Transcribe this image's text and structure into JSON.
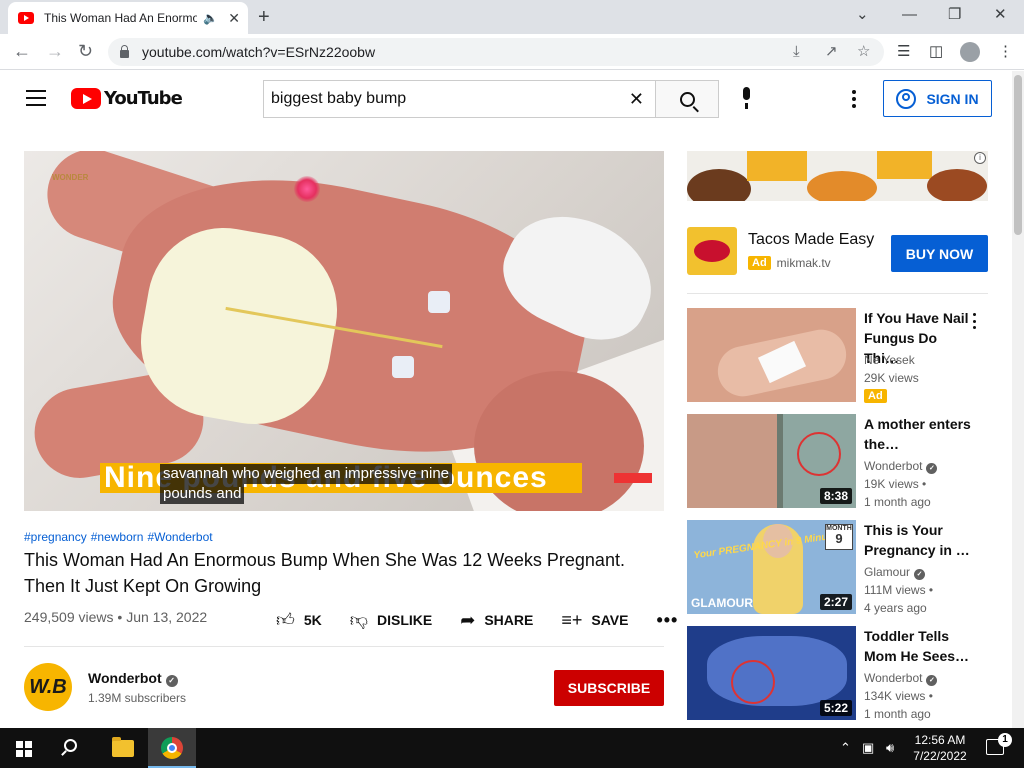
{
  "browser": {
    "tab_title": "This Woman Had An Enormous Bump When She Was 12 Weeks Pregnant. Then It Just Kept On Growing",
    "url": "youtube.com/watch?v=ESrNz22oobw"
  },
  "masthead": {
    "logo_text": "YouTube",
    "search_value": "biggest baby bump",
    "sign_in_label": "SIGN IN"
  },
  "player": {
    "caption_line1": "savannah who weighed an impressive nine",
    "caption_line2": "pounds and",
    "banner_text": "Nine pounds and five ounces",
    "watermark": "WONDER"
  },
  "video": {
    "hashtags": [
      "#pregnancy",
      "#newborn",
      "#Wonderbot"
    ],
    "title": "This Woman Had An Enormous Bump When She Was 12 Weeks Pregnant. Then It Just Kept On Growing",
    "views": "249,509 views",
    "date": "Jun 13, 2022",
    "like_count": "5K",
    "dislike_label": "DISLIKE",
    "share_label": "SHARE",
    "save_label": "SAVE"
  },
  "channel": {
    "name": "Wonderbot",
    "subscribers": "1.39M subscribers",
    "avatar_text": "W.B",
    "subscribe_label": "SUBSCRIBE"
  },
  "ad": {
    "title": "Tacos Made Easy",
    "badge": "Ad",
    "domain": "mikmak.tv",
    "cta": "BUY NOW"
  },
  "recommendations": [
    {
      "title": "If You Have Nail Fungus Do Thi…",
      "channel": "Ne Yesek",
      "views": "29K views",
      "badge": "Ad",
      "age": "",
      "duration": ""
    },
    {
      "title": "A mother enters the…",
      "channel": "Wonderbot",
      "views": "19K views",
      "age": "1 month ago",
      "duration": "8:38"
    },
    {
      "title": "This is Your Pregnancy in …",
      "channel": "Glamour",
      "views": "111M views",
      "age": "4 years ago",
      "duration": "2:27",
      "thumb_text": "Your PREGNANCY in 9 Minutes",
      "thumb_brand": "GLAMOUR",
      "thumb_month_label": "MONTH",
      "thumb_month": "9"
    },
    {
      "title": "Toddler Tells Mom He Sees…",
      "channel": "Wonderbot",
      "views": "134K views",
      "age": "1 month ago",
      "duration": "5:22"
    }
  ],
  "taskbar": {
    "time": "12:56 AM",
    "date": "7/22/2022",
    "notifications": "1"
  },
  "colors": {
    "yt_red": "#ff0000",
    "link_blue": "#065fd4",
    "subscribe_red": "#cc0000",
    "ad_yellow": "#f7b500"
  }
}
